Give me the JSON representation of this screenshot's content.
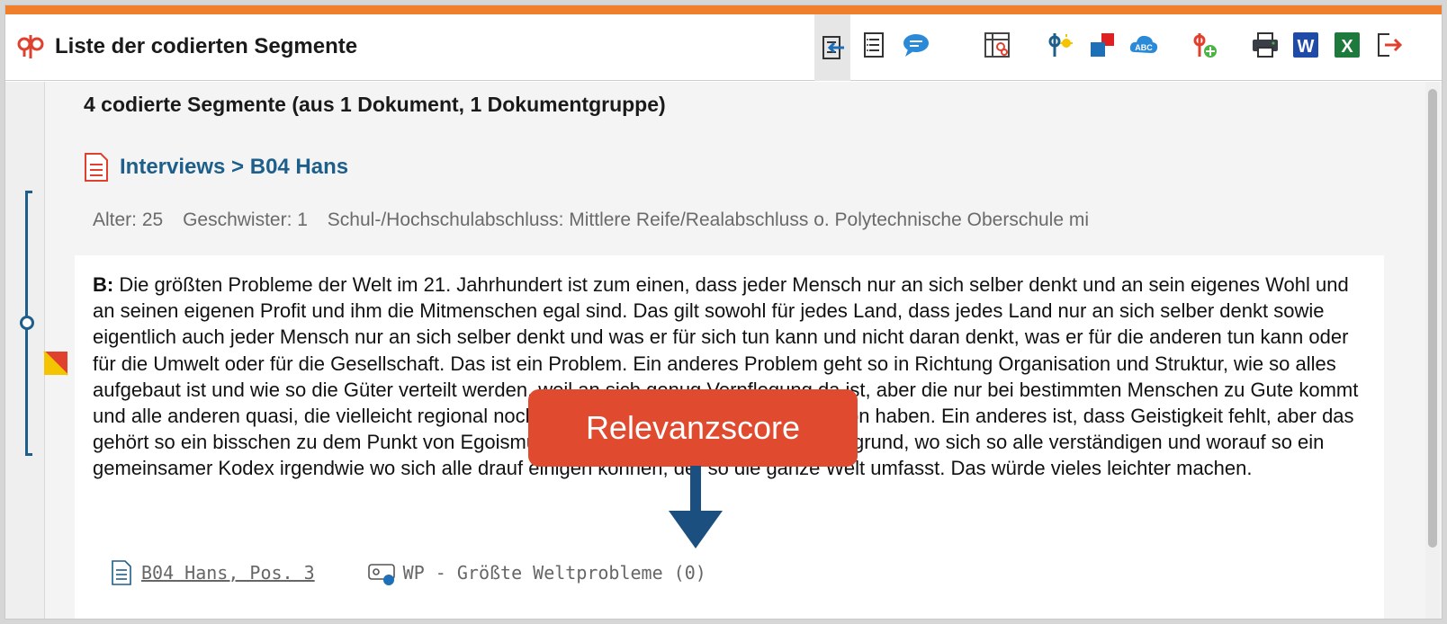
{
  "window": {
    "title": "Liste der codierten Segmente",
    "accent_color": "#f07f2c"
  },
  "toolbar": {
    "buttons": [
      {
        "name": "sync-icon",
        "active": true
      },
      {
        "name": "document-list-icon"
      },
      {
        "name": "comment-icon"
      },
      {
        "name": "code-matrix-icon"
      },
      {
        "name": "smart-coding-icon"
      },
      {
        "name": "color-code-icon"
      },
      {
        "name": "word-cloud-icon"
      },
      {
        "name": "add-code-icon"
      },
      {
        "name": "print-icon"
      },
      {
        "name": "word-export-icon"
      },
      {
        "name": "excel-export-icon"
      },
      {
        "name": "export-exit-icon"
      }
    ],
    "word_label": "W",
    "excel_label": "X",
    "abc_label": "ABC"
  },
  "summary": "4 codierte Segmente (aus 1 Dokument, 1 Dokumentgruppe)",
  "document": {
    "link": "Interviews > B04 Hans",
    "variables": [
      "Alter: 25",
      "Geschwister: 1",
      "Schul-/Hochschulabschluss: Mittlere Reife/Realabschluss o. Polytechnische Oberschule mi"
    ]
  },
  "segment": {
    "speaker": "B:",
    "text": "Die größten Probleme der Welt im 21. Jahrhundert ist zum einen, dass jeder Mensch nur an sich selber denkt und an sein eigenes Wohl und an seinen eigenen Profit und ihm die Mitmenschen egal sind. Das gilt sowohl für jedes Land, dass jedes Land nur an sich selber denkt sowie eigentlich auch jeder Mensch nur an sich selber denkt und was er für sich tun kann und nicht daran denkt, was er für die anderen tun kann oder für die Umwelt oder für die Gesellschaft. Das ist ein Problem. Ein anderes Problem geht so in Richtung Organisation und Struktur, wie so alles aufgebaut ist und wie so die Güter verteilt werden, weil an sich genug Verpflegung da ist, aber die nur bei bestimmten Menschen zu Gute kommt und alle anderen quasi, die vielleicht regional noch mehr abgeschottet sind, nichts davon haben. Ein anderes ist, dass Geistigkeit fehlt, aber das gehört so ein bisschen zu dem Punkt von Egoismus, ist das so ein gemeinsamer Untergrund, wo sich so alle verständigen und worauf so ein gemeinsamer Kodex irgendwie wo sich alle drauf einigen können, der so die ganze Welt umfasst. Das würde vieles leichter machen.",
    "source": "B04 Hans, Pos. 3",
    "code": "WP - Größte Weltprobleme (0)"
  },
  "callout": {
    "label": "Relevanzscore",
    "color": "#e04a2f"
  },
  "colors": {
    "link_blue": "#1d5f8a",
    "bracket_blue": "#1d5f8a"
  }
}
